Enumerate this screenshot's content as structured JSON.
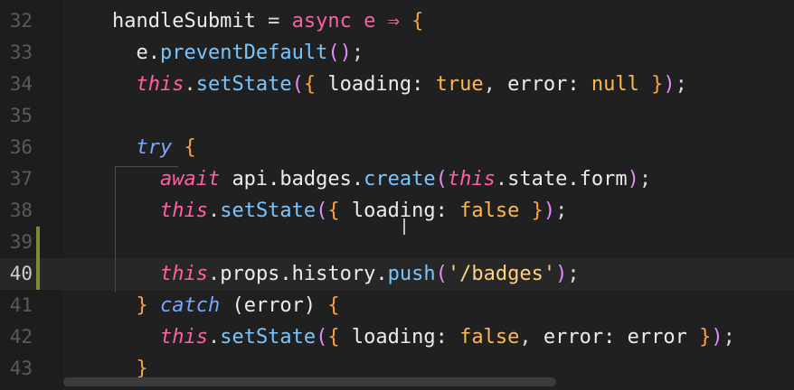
{
  "editor": {
    "lines": [
      {
        "num": "32",
        "tokens": [
          [
            "id",
            "    handleSubmit "
          ],
          [
            "punct",
            "= "
          ],
          [
            "kw",
            "async "
          ],
          [
            "kw",
            "e "
          ],
          [
            "kw",
            "⇒ "
          ],
          [
            "br",
            "{"
          ]
        ]
      },
      {
        "num": "33",
        "tokens": [
          [
            "id",
            "      e."
          ],
          [
            "fn",
            "preventDefault"
          ],
          [
            "br2",
            "()"
          ],
          [
            "punct",
            ";"
          ]
        ]
      },
      {
        "num": "34",
        "tokens": [
          [
            "kwi",
            "      this"
          ],
          [
            "punct",
            "."
          ],
          [
            "fn",
            "setState"
          ],
          [
            "br2",
            "("
          ],
          [
            "br",
            "{ "
          ],
          [
            "id",
            "loading: "
          ],
          [
            "lit",
            "true"
          ],
          [
            "punct",
            ", "
          ],
          [
            "id",
            "error: "
          ],
          [
            "lit",
            "null "
          ],
          [
            "br",
            "}"
          ],
          [
            "br2",
            ")"
          ],
          [
            "punct",
            ";"
          ]
        ]
      },
      {
        "num": "35",
        "tokens": []
      },
      {
        "num": "36",
        "tokens": [
          [
            "ctl",
            "      try "
          ],
          [
            "br",
            "{"
          ]
        ]
      },
      {
        "num": "37",
        "tokens": [
          [
            "kwi",
            "        await "
          ],
          [
            "id",
            "api.badges."
          ],
          [
            "fn",
            "create"
          ],
          [
            "br2",
            "("
          ],
          [
            "kwi",
            "this"
          ],
          [
            "punct",
            "."
          ],
          [
            "id",
            "state.form"
          ],
          [
            "br2",
            ")"
          ],
          [
            "punct",
            ";"
          ]
        ]
      },
      {
        "num": "38",
        "tokens": [
          [
            "kwi",
            "        this"
          ],
          [
            "punct",
            "."
          ],
          [
            "fn",
            "setState"
          ],
          [
            "br2",
            "("
          ],
          [
            "br",
            "{ "
          ],
          [
            "id",
            "loading: "
          ],
          [
            "lit",
            "false "
          ],
          [
            "br",
            "}"
          ],
          [
            "br2",
            ")"
          ],
          [
            "punct",
            ";"
          ]
        ]
      },
      {
        "num": "39",
        "tokens": []
      },
      {
        "num": "40",
        "tokens": [
          [
            "kwi",
            "        this"
          ],
          [
            "punct",
            "."
          ],
          [
            "id",
            "props.history."
          ],
          [
            "fn",
            "push"
          ],
          [
            "br2",
            "("
          ],
          [
            "str",
            "'/badges'"
          ],
          [
            "br2",
            ")"
          ],
          [
            "punct",
            ";"
          ]
        ]
      },
      {
        "num": "41",
        "tokens": [
          [
            "br",
            "      } "
          ],
          [
            "ctl",
            "catch "
          ],
          [
            "id",
            "(error) "
          ],
          [
            "br",
            "{"
          ]
        ]
      },
      {
        "num": "42",
        "tokens": [
          [
            "kwi",
            "        this"
          ],
          [
            "punct",
            "."
          ],
          [
            "fn",
            "setState"
          ],
          [
            "br2",
            "("
          ],
          [
            "br",
            "{ "
          ],
          [
            "id",
            "loading: "
          ],
          [
            "lit",
            "false"
          ],
          [
            "punct",
            ", "
          ],
          [
            "id",
            "error: error "
          ],
          [
            "br",
            "}"
          ],
          [
            "br2",
            ")"
          ],
          [
            "punct",
            ";"
          ]
        ]
      },
      {
        "num": "43",
        "tokens": [
          [
            "br",
            "      }"
          ]
        ]
      }
    ],
    "active_line": "40",
    "modified_lines": [
      "39",
      "40"
    ]
  }
}
